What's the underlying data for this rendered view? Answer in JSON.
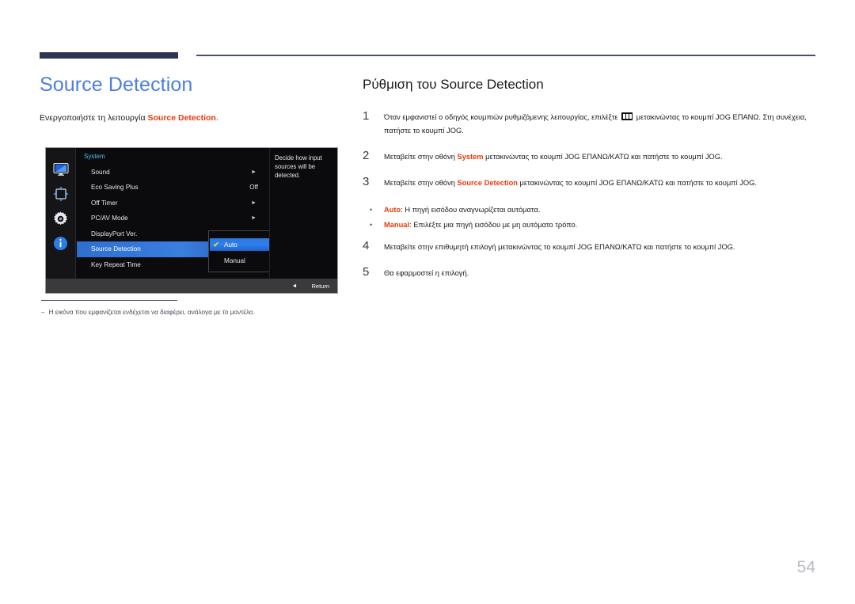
{
  "document": {
    "page_number": "54",
    "accent_title_color": "#4a7ee0",
    "highlight_color": "#e8380d",
    "rule_color": "#2e3554"
  },
  "left": {
    "title": "Source Detection",
    "intro_prefix": "Ενεργοποιήστε τη λειτουργία ",
    "intro_highlight": "Source Detection",
    "intro_suffix": ".",
    "footnote_dash": "‒",
    "footnote": "Η εικόνα που εμφανίζεται ενδέχεται να διαφέρει, ανάλογα με το μοντέλο."
  },
  "osd": {
    "menu_title": "System",
    "icons": [
      {
        "name": "display-icon",
        "label": "Picture"
      },
      {
        "name": "screen-adjust-icon",
        "label": "Screen Adjustment"
      },
      {
        "name": "gear-icon",
        "label": "System"
      },
      {
        "name": "info-icon",
        "label": "Information"
      }
    ],
    "rows": [
      {
        "label": "Sound",
        "value": "",
        "arrow": "►",
        "selected": false
      },
      {
        "label": "Eco Saving Plus",
        "value": "Off",
        "arrow": "",
        "selected": false
      },
      {
        "label": "Off Timer",
        "value": "",
        "arrow": "►",
        "selected": false
      },
      {
        "label": "PC/AV Mode",
        "value": "",
        "arrow": "►",
        "selected": false
      },
      {
        "label": "DisplayPort Ver.",
        "value": "",
        "arrow": "",
        "selected": false
      },
      {
        "label": "Source Detection",
        "value": "",
        "arrow": "",
        "selected": true
      },
      {
        "label": "Key Repeat Time",
        "value": "",
        "arrow": "",
        "selected": false
      }
    ],
    "submenu": [
      {
        "label": "Auto",
        "checked": true,
        "selected": true
      },
      {
        "label": "Manual",
        "checked": false,
        "selected": false
      }
    ],
    "check_glyph": "✔",
    "description": "Decide how input sources will be detected.",
    "footer_back_glyph": "◄",
    "footer_label": "Return"
  },
  "right": {
    "title": "Ρύθμιση του Source Detection",
    "steps": [
      {
        "num": "1",
        "parts": [
          {
            "t": "text",
            "v": "Όταν εμφανιστεί ο οδηγός κουμπιών ρυθμιζόμενης λειτουργίας, επιλέξτε "
          },
          {
            "t": "icon",
            "v": "menu-icon"
          },
          {
            "t": "text",
            "v": " μετακινώντας το κουμπί JOG ΕΠΑΝΩ. Στη συνέχεια, πατήστε το κουμπί JOG."
          }
        ]
      },
      {
        "num": "2",
        "parts": [
          {
            "t": "text",
            "v": "Μεταβείτε στην οθόνη "
          },
          {
            "t": "hl",
            "v": "System"
          },
          {
            "t": "text",
            "v": " μετακινώντας το κουμπί JOG ΕΠΑΝΩ/ΚΑΤΩ και πατήστε το κουμπί JOG."
          }
        ]
      },
      {
        "num": "3",
        "parts": [
          {
            "t": "text",
            "v": "Μεταβείτε στην οθόνη "
          },
          {
            "t": "hl",
            "v": "Source Detection"
          },
          {
            "t": "text",
            "v": " μετακινώντας το κουμπί JOG ΕΠΑΝΩ/ΚΑΤΩ και πατήστε το κουμπί JOG."
          }
        ]
      }
    ],
    "bullets": [
      {
        "dot": "•",
        "term": "Auto",
        "rest": ": Η πηγή εισόδου αναγνωρίζεται αυτόματα."
      },
      {
        "dot": "•",
        "term": "Manual",
        "rest": ": Επιλέξτε μια πηγή εισόδου με μη αυτόματο τρόπο."
      }
    ],
    "steps_after": [
      {
        "num": "4",
        "parts": [
          {
            "t": "text",
            "v": "Μεταβείτε στην επιθυμητή επιλογή μετακινώντας το κουμπί JOG ΕΠΑΝΩ/ΚΑΤΩ και πατήστε το κουμπί JOG."
          }
        ]
      },
      {
        "num": "5",
        "parts": [
          {
            "t": "text",
            "v": "Θα εφαρμοστεί η επιλογή."
          }
        ]
      }
    ]
  }
}
